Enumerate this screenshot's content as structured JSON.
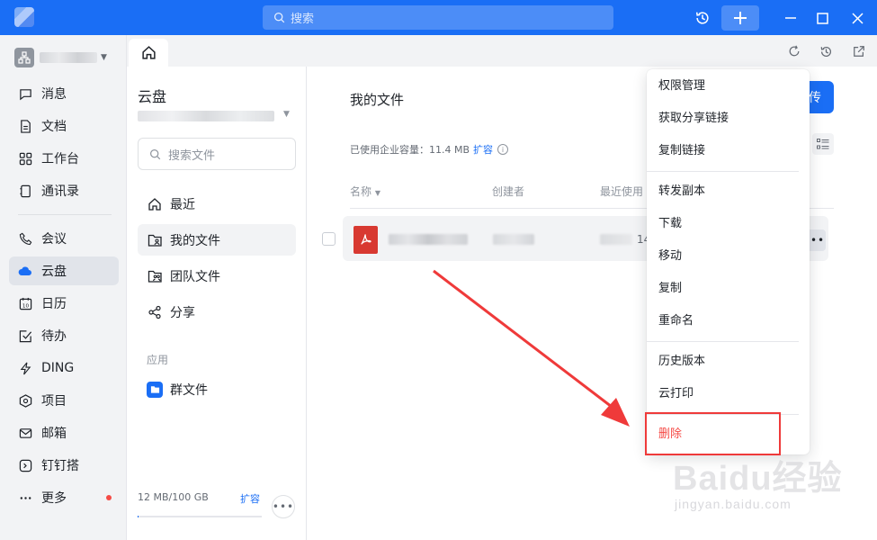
{
  "titlebar": {
    "search_placeholder": "搜索"
  },
  "nav": {
    "items": [
      {
        "label": "消息",
        "icon": "message-icon"
      },
      {
        "label": "文档",
        "icon": "document-icon"
      },
      {
        "label": "工作台",
        "icon": "workbench-icon"
      },
      {
        "label": "通讯录",
        "icon": "contacts-icon"
      },
      {
        "label": "会议",
        "icon": "phone-icon"
      },
      {
        "label": "云盘",
        "icon": "cloud-icon",
        "active": true
      },
      {
        "label": "日历",
        "icon": "calendar-icon"
      },
      {
        "label": "待办",
        "icon": "todo-icon"
      },
      {
        "label": "DING",
        "icon": "lightning-icon"
      },
      {
        "label": "项目",
        "icon": "project-icon"
      },
      {
        "label": "邮箱",
        "icon": "mail-icon"
      },
      {
        "label": "钉钉搭",
        "icon": "builder-icon"
      },
      {
        "label": "更多",
        "icon": "more-icon",
        "badge": true
      }
    ]
  },
  "sidebar": {
    "title": "云盘",
    "search_placeholder": "搜索文件",
    "items": [
      {
        "label": "最近",
        "icon": "home-icon"
      },
      {
        "label": "我的文件",
        "icon": "my-files-icon",
        "active": true
      },
      {
        "label": "团队文件",
        "icon": "team-files-icon"
      },
      {
        "label": "分享",
        "icon": "share-icon"
      }
    ],
    "section_label": "应用",
    "app_item": {
      "label": "群文件",
      "icon": "group-folder-icon"
    },
    "quota_text": "12 MB/100 GB",
    "quota_expand": "扩容",
    "quota_fraction": 0.0001
  },
  "main": {
    "title": "我的文件",
    "upload_label": "传",
    "usage_text": "已使用企业容量：11.4 MB",
    "usage_link": "扩容",
    "columns": {
      "name": "名称",
      "creator": "创建者",
      "last_used": "最近使用"
    },
    "row_time_fragment": "14"
  },
  "context_menu": {
    "items": [
      "权限管理",
      "获取分享链接",
      "复制链接",
      "转发副本",
      "下载",
      "移动",
      "复制",
      "重命名",
      "历史版本",
      "云打印",
      "删除"
    ],
    "danger_index": 10
  },
  "watermark": {
    "text": "Baidu经验",
    "url": "jingyan.baidu.com"
  },
  "colors": {
    "brand_blue": "#1a6ef5",
    "danger_red": "#f54a45",
    "annotation_red": "#ef3a3a"
  }
}
